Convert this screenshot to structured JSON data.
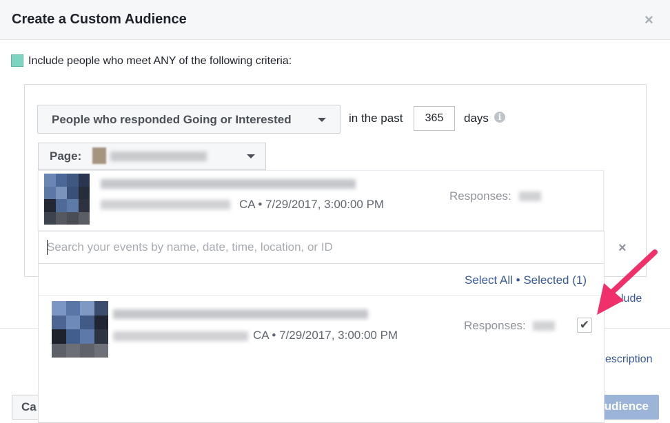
{
  "dialog": {
    "title": "Create a Custom Audience",
    "close_glyph": "×"
  },
  "criteria": {
    "label": "Include people who meet ANY of the following criteria:"
  },
  "rule": {
    "event_type": "People who responded Going or Interested",
    "in_the_past_label": "in the past",
    "days_value": "365",
    "days_label": "days",
    "info_glyph": "i"
  },
  "page_selector": {
    "label": "Page:"
  },
  "selected_event": {
    "location_suffix": "CA • 7/29/2017, 3:00:00 PM",
    "responses_label": "Responses:"
  },
  "search": {
    "placeholder": "Search your events by name, date, time, location, or ID",
    "clear_glyph": "×"
  },
  "results": {
    "select_all_text": "Select All • Selected (1)",
    "items": [
      {
        "location_suffix": "CA • 7/29/2017, 3:00:00 PM",
        "responses_label": "Responses:",
        "checked": true,
        "check_glyph": "✔"
      }
    ]
  },
  "background": {
    "include_link_fragment": "lude",
    "description_link_fragment": "escription"
  },
  "footer": {
    "cancel_label": "Ca",
    "create_label": "udience"
  },
  "colors": {
    "accent_link": "#365899",
    "annotation_arrow": "#f0306a",
    "criteria_box": "#7fd4c1",
    "create_button": "#9cb4d8"
  }
}
